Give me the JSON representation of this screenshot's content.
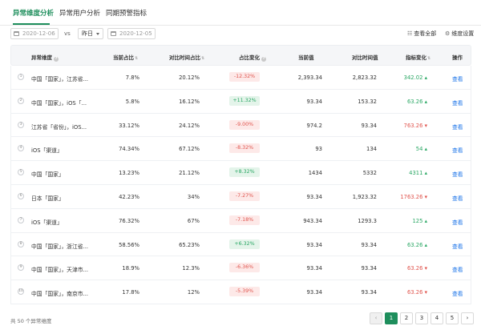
{
  "tabs": [
    {
      "label": "异常维度分析",
      "active": true
    },
    {
      "label": "异常用户分析",
      "active": false
    },
    {
      "label": "同期预警指标",
      "active": false
    }
  ],
  "filters": {
    "start_date": "2020-12-06",
    "vs_label": "vs",
    "compare_option": "昨日",
    "compare_date": "2020-12-05",
    "view_all_label": "查看全部",
    "dimension_settings_label": "维度设置"
  },
  "columns": {
    "dimension": "异常维度",
    "current_share": "当前占比",
    "compare_share": "对比时间占比",
    "share_change": "占比变化",
    "current_value": "当前值",
    "compare_value": "对比时间值",
    "metric_change": "指标变化",
    "action": "操作"
  },
  "rows": [
    {
      "idx": "1",
      "dimension": "中国「国家」，江苏省...",
      "current_share": "7.8%",
      "compare_share": "20.12%",
      "share_change": "-12.32%",
      "share_dir": "neg",
      "current_value": "2,393.34",
      "compare_value": "2,823.32",
      "metric_change": "342.02 ▴",
      "metric_dir": "up",
      "action": "查看"
    },
    {
      "idx": "2",
      "dimension": "中国「国家」，iOS「...",
      "current_share": "5.8%",
      "compare_share": "16.12%",
      "share_change": "+11.32%",
      "share_dir": "pos",
      "current_value": "93.34",
      "compare_value": "153.32",
      "metric_change": "63.26 ▴",
      "metric_dir": "up",
      "action": "查看"
    },
    {
      "idx": "3",
      "dimension": "江苏省「省份」，iOS...",
      "current_share": "33.12%",
      "compare_share": "24.12%",
      "share_change": "-9.00%",
      "share_dir": "neg",
      "current_value": "974.2",
      "compare_value": "93.34",
      "metric_change": "763.26 ▾",
      "metric_dir": "down",
      "action": "查看"
    },
    {
      "idx": "4",
      "dimension": "iOS「渠道」",
      "current_share": "74.34%",
      "compare_share": "67.12%",
      "share_change": "-8.32%",
      "share_dir": "neg",
      "current_value": "93",
      "compare_value": "134",
      "metric_change": "54 ▴",
      "metric_dir": "up",
      "action": "查看"
    },
    {
      "idx": "5",
      "dimension": "中国「国家」",
      "current_share": "13.23%",
      "compare_share": "21.12%",
      "share_change": "+8.32%",
      "share_dir": "pos",
      "current_value": "1434",
      "compare_value": "5332",
      "metric_change": "4311 ▴",
      "metric_dir": "up",
      "action": "查看"
    },
    {
      "idx": "6",
      "dimension": "日本「国家」",
      "current_share": "42.23%",
      "compare_share": "34%",
      "share_change": "-7.27%",
      "share_dir": "neg",
      "current_value": "93.34",
      "compare_value": "1,923.32",
      "metric_change": "1763.26 ▾",
      "metric_dir": "down",
      "action": "查看"
    },
    {
      "idx": "7",
      "dimension": "iOS「渠道」",
      "current_share": "76.32%",
      "compare_share": "67%",
      "share_change": "-7.18%",
      "share_dir": "neg",
      "current_value": "943.34",
      "compare_value": "1293.3",
      "metric_change": "125 ▴",
      "metric_dir": "up",
      "action": "查看"
    },
    {
      "idx": "8",
      "dimension": "中国「国家」，浙江省...",
      "current_share": "58.56%",
      "compare_share": "65.23%",
      "share_change": "+6.32%",
      "share_dir": "pos",
      "current_value": "93.34",
      "compare_value": "93.34",
      "metric_change": "63.26 ▴",
      "metric_dir": "up",
      "action": "查看"
    },
    {
      "idx": "9",
      "dimension": "中国「国家」，天津市...",
      "current_share": "18.9%",
      "compare_share": "12.3%",
      "share_change": "-6.36%",
      "share_dir": "neg",
      "current_value": "93.34",
      "compare_value": "93.34",
      "metric_change": "63.26 ▾",
      "metric_dir": "down",
      "action": "查看"
    },
    {
      "idx": "10",
      "dimension": "中国「国家」，南京市...",
      "current_share": "17.8%",
      "compare_share": "12%",
      "share_change": "-5.39%",
      "share_dir": "neg",
      "current_value": "93.34",
      "compare_value": "93.34",
      "metric_change": "63.26 ▾",
      "metric_dir": "down",
      "action": "查看"
    }
  ],
  "footer": {
    "total_label": "共 50 个异常维度",
    "pages": [
      "1",
      "2",
      "3",
      "4",
      "5"
    ],
    "current_page": "1",
    "prev_icon": "chevron-left-icon",
    "next_icon": "chevron-right-icon"
  },
  "colors": {
    "accent": "#1e8e5c",
    "link": "#1a73e8",
    "negative": "#e0544d",
    "positive": "#2aa764"
  }
}
